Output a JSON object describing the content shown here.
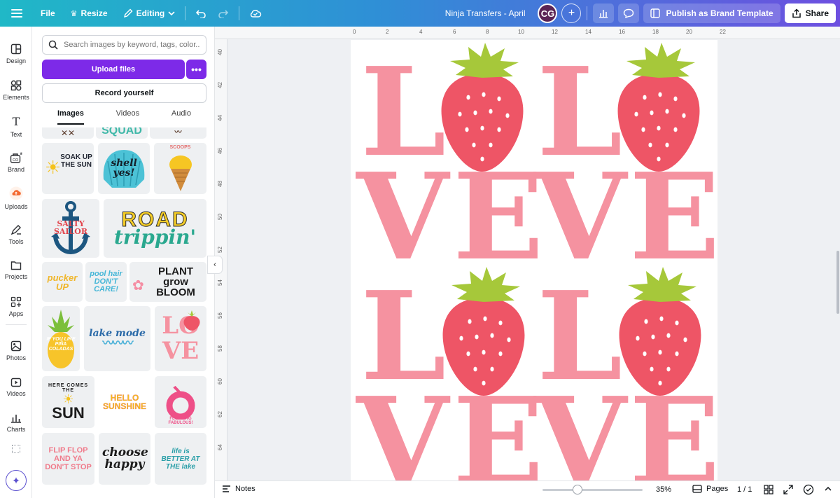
{
  "topbar": {
    "file_label": "File",
    "resize_label": "Resize",
    "editing_label": "Editing",
    "doc_title": "Ninja Transfers - April",
    "avatar_initials": "CG",
    "publish_label": "Publish as Brand Template",
    "share_label": "Share"
  },
  "rail": {
    "items": [
      {
        "label": "Design",
        "icon": "design-icon"
      },
      {
        "label": "Elements",
        "icon": "elements-icon"
      },
      {
        "label": "Text",
        "icon": "text-icon"
      },
      {
        "label": "Brand",
        "icon": "brand-icon"
      },
      {
        "label": "Uploads",
        "icon": "uploads-icon"
      },
      {
        "label": "Tools",
        "icon": "tools-icon"
      },
      {
        "label": "Projects",
        "icon": "projects-icon"
      },
      {
        "label": "Apps",
        "icon": "apps-icon"
      },
      {
        "label": "Photos",
        "icon": "photos-icon"
      },
      {
        "label": "Videos",
        "icon": "videos-icon"
      },
      {
        "label": "Charts",
        "icon": "charts-icon"
      }
    ]
  },
  "panel": {
    "search_placeholder": "Search images by keyword, tags, color...",
    "upload_label": "Upload files",
    "more_label": "•••",
    "record_label": "Record yourself",
    "tabs": [
      "Images",
      "Videos",
      "Audio"
    ],
    "thumbs": {
      "squad": "SQUAD",
      "soak": "SOAK UP THE SUN",
      "shell": "shell yes!",
      "scoops": "SCOOPS",
      "salty": "SALTY SAILOR",
      "road": "ROAD",
      "trippin": "trippin'",
      "pucker": "pucker UP",
      "pool": "pool hair DON'T CARE!",
      "plant": "PLANT grow BLOOM",
      "pina": "IF YOU LIKE PIÑA COLADAS",
      "lake": "lake mode",
      "love_thumb": "LO VE",
      "here": "HERE COMES THE",
      "sun": "SUN",
      "hello": "HELLO SUNSHINE",
      "flocking": "FLOCKING FABULOUS!",
      "flip": "FLIP FLOP AND YA DON'T STOP",
      "choose": "choose happy",
      "better": "life is BETTER AT THE lake"
    }
  },
  "canvas": {
    "letters": {
      "l": "L",
      "v": "V",
      "e": "E"
    },
    "ruler_top": [
      "0",
      "2",
      "4",
      "6",
      "8",
      "10",
      "12",
      "14",
      "16",
      "18",
      "20",
      "22"
    ],
    "ruler_left": [
      "40",
      "42",
      "44",
      "46",
      "48",
      "50",
      "52",
      "54",
      "56",
      "58",
      "60",
      "62",
      "64"
    ],
    "colors": {
      "letter_pink": "#f592a0",
      "berry_red": "#ee5566",
      "leaf_green": "#a6c83a",
      "accent_purple": "#7d2ae8"
    }
  },
  "bottombar": {
    "notes_label": "Notes",
    "zoom": "35%",
    "pages_label": "Pages",
    "page_count": "1 / 1"
  }
}
